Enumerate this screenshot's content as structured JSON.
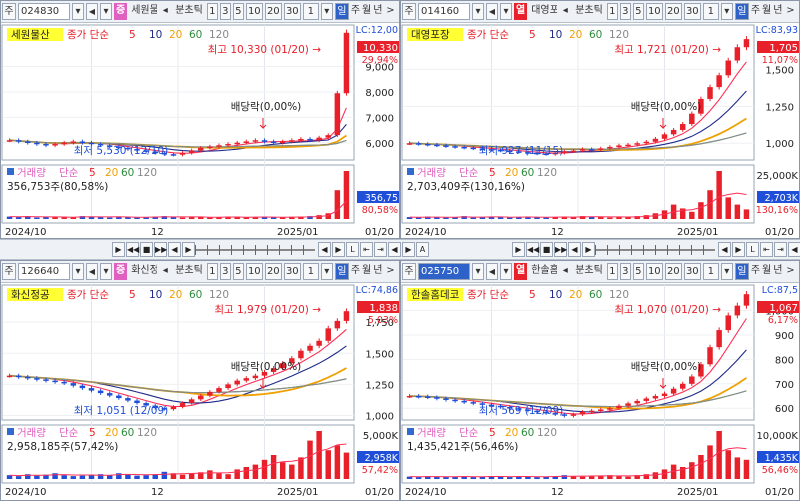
{
  "colors": {
    "up": "#e8202a",
    "down": "#1f4fd8",
    "ma5": "#ff2d55",
    "ma10": "#1f2a8a",
    "ma20": "#f0a000",
    "ma60": "#2e8b3e",
    "ma120": "#8c8c8c",
    "price_box": "#e8202a",
    "hilite": "#ffff33"
  },
  "labels": {
    "ma_type": "종가 단순",
    "vol_title": "거래량",
    "vol_type": "단순",
    "ma_periods": [
      "5",
      "10",
      "20",
      "60",
      "120"
    ],
    "vol_periods": [
      "5",
      "20",
      "60",
      "120"
    ],
    "x_ticks": [
      "2024/10",
      "12",
      "2025/01",
      "01/20"
    ],
    "ex_div": "배당락(0,00%)",
    "toolbar": {
      "market": "주",
      "day": "일",
      "week": "주",
      "month": "월",
      "year": "년",
      "tick": "분초틱",
      "nums": [
        "1",
        "3",
        "5",
        "10",
        "20",
        "30"
      ],
      "cnt": "1"
    }
  },
  "control_bar": {
    "left": [
      "▶",
      "◀◀",
      "■",
      "▶▶",
      "◀",
      "▶"
    ],
    "right": [
      "◀",
      "▶",
      "L",
      "⇤",
      "⇥",
      "◀",
      "▶",
      "A"
    ]
  },
  "panels": [
    {
      "id": "p1",
      "code": "024830",
      "badge": "증",
      "badge_color": "#e060c0",
      "name": "세원물산",
      "title": "세원물산",
      "high": "최고 10,330 (01/20)",
      "low": "최저 5,530 (12/10)",
      "lc": "LC:12,00",
      "price": "10,330",
      "pct": "29,94%",
      "vol": "356,753주(80,58%)",
      "vol_box": "356,75",
      "vol_pct": "80,58%",
      "y_ticks": [
        "9,000",
        "8,000",
        "7,000",
        "6,000"
      ],
      "vol_ticks": [],
      "code_selected": false,
      "chart_data": {
        "type": "candlestick",
        "x": [
          "2024/10",
          "12",
          "2025/01",
          "01/20"
        ],
        "close_path": [
          6100,
          6050,
          6000,
          5950,
          5900,
          5950,
          6000,
          6050,
          6000,
          5950,
          5900,
          5850,
          5800,
          5750,
          5700,
          5650,
          5600,
          5550,
          5530,
          5600,
          5700,
          5800,
          5850,
          5900,
          5950,
          6000,
          6050,
          6100,
          6050,
          6000,
          6050,
          6100,
          6150,
          6100,
          6200,
          6300,
          7950,
          10330
        ],
        "ylim": [
          5400,
          10400
        ],
        "vol_path": [
          5,
          4,
          6,
          3,
          4,
          5,
          3,
          4,
          6,
          5,
          4,
          3,
          5,
          4,
          3,
          4,
          5,
          6,
          4,
          3,
          4,
          5,
          3,
          4,
          5,
          4,
          3,
          4,
          5,
          4,
          3,
          4,
          5,
          6,
          8,
          12,
          60,
          100
        ]
      }
    },
    {
      "id": "p2",
      "code": "014160",
      "badge": "열",
      "badge_color": "#e8202a",
      "name": "대영포장",
      "title": "대영포장",
      "high": "최고 1,721 (01/20)",
      "low": "최저 927 (11/15)",
      "lc": "LC:83,93",
      "price": "1,705",
      "pct": "11,07%",
      "vol": "2,703,409주(130,16%)",
      "vol_box": "2,703K",
      "vol_pct": "130,16%",
      "y_ticks": [
        "1,500",
        "1,250",
        "1,000"
      ],
      "vol_ticks": [
        "25,000K"
      ],
      "code_selected": false,
      "chart_data": {
        "type": "candlestick",
        "x": [
          "2024/10",
          "12",
          "2025/01",
          "01/20"
        ],
        "close_path": [
          1000,
          995,
          990,
          985,
          980,
          975,
          970,
          965,
          960,
          955,
          950,
          945,
          940,
          935,
          930,
          927,
          935,
          945,
          950,
          960,
          955,
          965,
          975,
          985,
          990,
          1000,
          1010,
          1030,
          1060,
          1090,
          1130,
          1200,
          1300,
          1380,
          1460,
          1560,
          1650,
          1705
        ],
        "ylim": [
          900,
          1760
        ],
        "vol_path": [
          4,
          3,
          5,
          4,
          3,
          4,
          6,
          3,
          4,
          5,
          4,
          3,
          4,
          5,
          4,
          3,
          4,
          5,
          4,
          6,
          5,
          4,
          3,
          4,
          5,
          6,
          8,
          12,
          18,
          30,
          22,
          15,
          35,
          60,
          100,
          45,
          30,
          20
        ]
      }
    },
    {
      "id": "p3",
      "code": "126640",
      "badge": "증",
      "badge_color": "#e060c0",
      "name": "화신정공",
      "title": "화신정공",
      "high": "최고 1,979 (01/20)",
      "low": "최저 1,051 (12/09)",
      "lc": "LC:74,86",
      "price": "1,838",
      "pct": "5,03%",
      "vol": "2,958,185주(57,42%)",
      "vol_box": "2,958K",
      "vol_pct": "57,42%",
      "y_ticks": [
        "1,750",
        "1,500",
        "1,250",
        "1,000"
      ],
      "vol_ticks": [
        "5,000K"
      ],
      "code_selected": false,
      "chart_data": {
        "type": "candlestick",
        "x": [
          "2024/10",
          "12",
          "2025/01",
          "01/20"
        ],
        "close_path": [
          1320,
          1310,
          1300,
          1290,
          1280,
          1270,
          1260,
          1240,
          1220,
          1200,
          1180,
          1160,
          1140,
          1120,
          1100,
          1080,
          1060,
          1051,
          1070,
          1100,
          1130,
          1160,
          1190,
          1220,
          1250,
          1280,
          1300,
          1320,
          1350,
          1380,
          1420,
          1460,
          1520,
          1560,
          1600,
          1700,
          1760,
          1838
        ],
        "ylim": [
          980,
          2000
        ],
        "vol_path": [
          8,
          6,
          10,
          7,
          9,
          12,
          8,
          6,
          7,
          9,
          10,
          8,
          12,
          9,
          7,
          8,
          10,
          15,
          12,
          9,
          11,
          14,
          18,
          12,
          10,
          20,
          25,
          30,
          40,
          50,
          35,
          30,
          45,
          80,
          100,
          60,
          70,
          55
        ]
      }
    },
    {
      "id": "p4",
      "code": "025750",
      "badge": "열",
      "badge_color": "#e8202a",
      "name": "한솔홈데코",
      "title": "한솔홈데코",
      "high": "최고 1,070 (01/20)",
      "low": "최저 569 (12/09)",
      "lc": "LC:87,5",
      "price": "1,067",
      "pct": "6,17%",
      "vol": "1,435,421주(56,46%)",
      "vol_box": "1,435K",
      "vol_pct": "56,46%",
      "y_ticks": [
        "1,000",
        "900",
        "800",
        "700",
        "600"
      ],
      "vol_ticks": [
        "10,000K"
      ],
      "code_selected": true,
      "chart_data": {
        "type": "candlestick",
        "x": [
          "2024/10",
          "12",
          "2025/01",
          "01/20"
        ],
        "close_path": [
          650,
          648,
          645,
          640,
          635,
          630,
          625,
          620,
          615,
          610,
          605,
          600,
          595,
          590,
          585,
          580,
          575,
          569,
          575,
          585,
          590,
          595,
          600,
          610,
          620,
          630,
          640,
          650,
          660,
          680,
          700,
          730,
          780,
          850,
          920,
          980,
          1020,
          1067
        ],
        "ylim": [
          560,
          1080
        ],
        "vol_path": [
          5,
          4,
          6,
          5,
          4,
          5,
          6,
          4,
          5,
          6,
          5,
          4,
          6,
          5,
          4,
          5,
          6,
          8,
          6,
          5,
          6,
          7,
          8,
          6,
          5,
          8,
          10,
          14,
          20,
          30,
          25,
          35,
          50,
          70,
          100,
          60,
          45,
          40
        ]
      }
    }
  ]
}
